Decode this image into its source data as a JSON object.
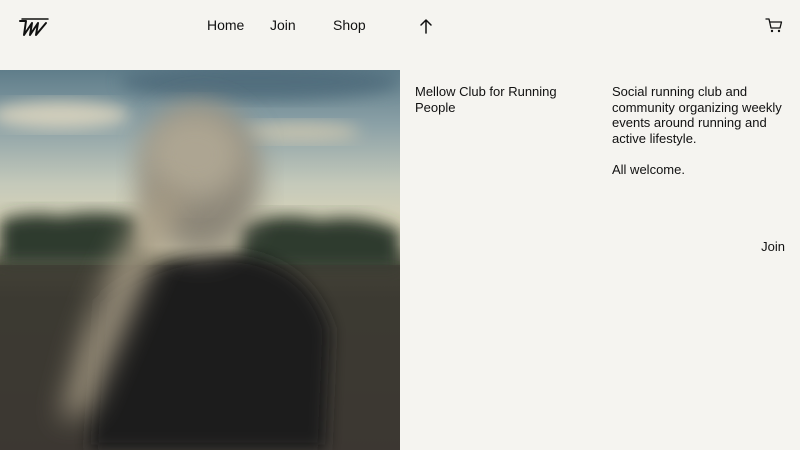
{
  "brand": {
    "logo_icon": "brand-logo-icon"
  },
  "nav": {
    "home_label": "Home",
    "join_label": "Join",
    "shop_label": "Shop",
    "scroll_icon": "arrow-up-icon",
    "cart_icon": "cart-icon"
  },
  "hero": {
    "image_icon": "runner-photo",
    "tagline": "Mellow Club for Running People"
  },
  "about": {
    "description": "Social running club and community organizing weekly events around running and active lifestyle.",
    "welcome": "All welcome.",
    "join_label": "Join"
  },
  "colors": {
    "background": "#f5f4f0",
    "text": "#111111"
  }
}
